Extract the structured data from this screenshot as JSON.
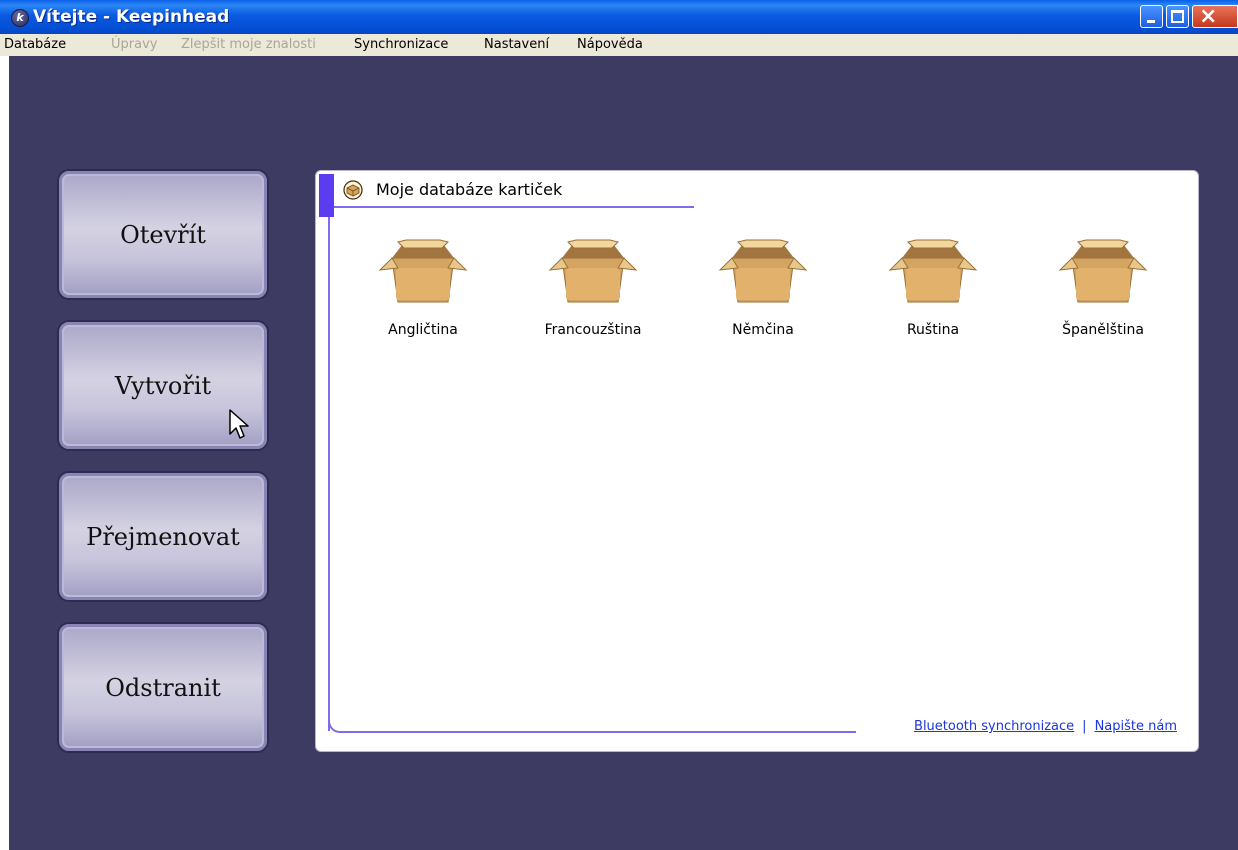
{
  "window": {
    "title": "Vítejte - Keepinhead",
    "icon_letter": "k",
    "controls": [
      "minimize-icon",
      "maximize-icon",
      "close-icon"
    ]
  },
  "menu": {
    "items": [
      {
        "label": "Databáze",
        "enabled": true
      },
      {
        "label": "Úpravy",
        "enabled": false
      },
      {
        "label": "Zlepšit moje znalosti",
        "enabled": false
      },
      {
        "label": "Synchronizace",
        "enabled": true
      },
      {
        "label": "Nastavení",
        "enabled": true
      },
      {
        "label": "Nápověda",
        "enabled": true
      }
    ]
  },
  "sidebar": {
    "buttons": [
      {
        "label": "Otevřít"
      },
      {
        "label": "Vytvořit"
      },
      {
        "label": "Přejmenovat"
      },
      {
        "label": "Odstranit"
      }
    ]
  },
  "panel": {
    "title": "Moje databáze kartiček",
    "icon": "box-icon",
    "databases": [
      {
        "label": "Angličtina",
        "icon": "box-icon"
      },
      {
        "label": "Francouzština",
        "icon": "box-icon"
      },
      {
        "label": "Němčina",
        "icon": "box-icon"
      },
      {
        "label": "Ruština",
        "icon": "box-icon"
      },
      {
        "label": "Španělština",
        "icon": "box-icon"
      }
    ],
    "footer": {
      "bluetooth_link": "Bluetooth synchronizace",
      "separator": "|",
      "contact_link": "Napište nám"
    }
  },
  "colors": {
    "background": "#3e3b63",
    "accent": "#5b3cf0",
    "link": "#1a36e0"
  }
}
